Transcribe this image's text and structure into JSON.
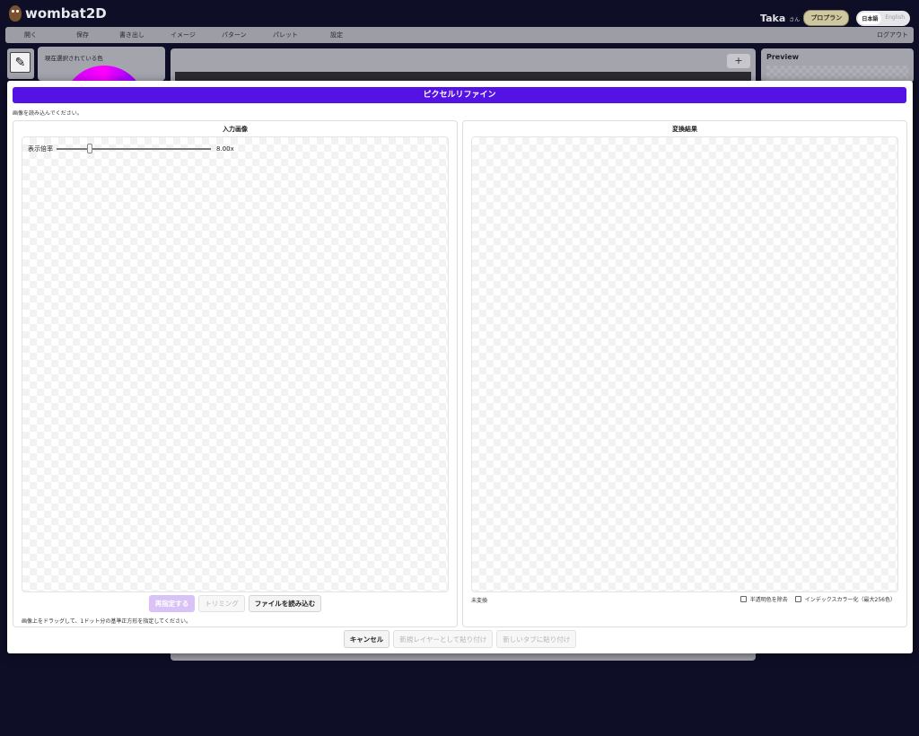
{
  "app": {
    "logo_text": "wombat2D",
    "user_name": "Taka",
    "user_suffix": "さん",
    "plan_badge": "プロプラン",
    "lang_ja": "日本語",
    "lang_en": "English"
  },
  "menu": {
    "items": [
      "開く",
      "保存",
      "書き出し",
      "イメージ",
      "パターン",
      "パレット",
      "設定"
    ],
    "logout": "ログアウト"
  },
  "panels": {
    "color_title": "現在選択されている色",
    "canvas_add": "+",
    "preview_title": "Preview"
  },
  "modal": {
    "title": "ピクセルリファイン",
    "status": "画像を読み込んでください。",
    "input": {
      "title": "入力画像",
      "zoom_label": "表示倍率",
      "zoom_value": "8.00x",
      "zoom_fraction": 0.2,
      "buttons": {
        "respecify": "再指定する",
        "trim": "トリミング",
        "load_file": "ファイルを読み込む"
      },
      "hint": "画像上をドラッグして、1ドット分の基準正方形を指定してください。"
    },
    "output": {
      "title": "変換結果",
      "status": "未変換",
      "option_remove_alpha": "半透明色を除去",
      "option_indexed": "インデックスカラー化（最大256色）"
    },
    "footer": {
      "cancel": "キャンセル",
      "paste_new_layer": "新規レイヤーとして貼り付け",
      "paste_new_tab": "新しいタブに貼り付け"
    }
  }
}
